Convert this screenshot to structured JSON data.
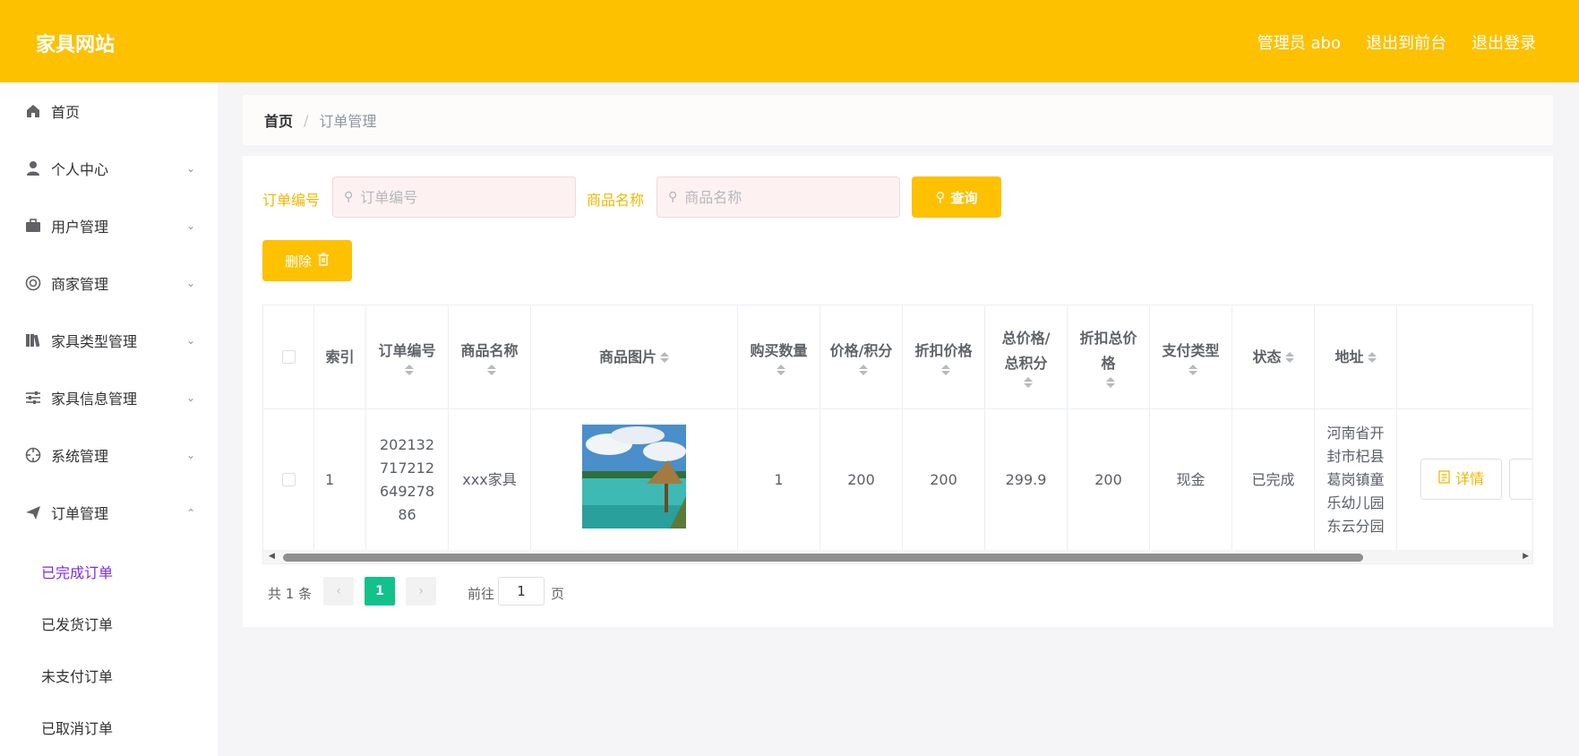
{
  "header": {
    "brand": "家具网站",
    "admin": "管理员 abo",
    "to_front": "退出到前台",
    "logout": "退出登录"
  },
  "sidebar": {
    "items": [
      {
        "label": "首页",
        "icon": "home-icon"
      },
      {
        "label": "个人中心",
        "icon": "user-icon"
      },
      {
        "label": "用户管理",
        "icon": "briefcase-icon"
      },
      {
        "label": "商家管理",
        "icon": "lifebuoy-icon"
      },
      {
        "label": "家具类型管理",
        "icon": "books-icon"
      },
      {
        "label": "家具信息管理",
        "icon": "sliders-icon"
      },
      {
        "label": "系统管理",
        "icon": "target-icon"
      },
      {
        "label": "订单管理",
        "icon": "send-icon"
      }
    ],
    "sub_items": [
      {
        "label": "已完成订单"
      },
      {
        "label": "已发货订单"
      },
      {
        "label": "未支付订单"
      },
      {
        "label": "已取消订单"
      }
    ],
    "active_color": "#7d2ae8"
  },
  "breadcrumb": {
    "home": "首页",
    "separator": "/",
    "current": "订单管理"
  },
  "search": {
    "order_no_label": "订单编号",
    "order_no_placeholder": "订单编号",
    "product_label": "商品名称",
    "product_placeholder": "商品名称",
    "query_button": "查询"
  },
  "actions": {
    "delete_button": "删除"
  },
  "table": {
    "headers": {
      "index": "索引",
      "order_no": "订单编号",
      "product_name": "商品名称",
      "product_image": "商品图片",
      "qty": "购买数量",
      "price": "价格/积分",
      "discount_price": "折扣价格",
      "total": "总价格/总积分",
      "discount_total": "折扣总价格",
      "pay_type": "支付类型",
      "status": "状态",
      "address": "地址"
    },
    "rows": [
      {
        "index": "1",
        "order_no": "20213271721264927886",
        "product_name": "xxx家具",
        "qty": "1",
        "price": "200",
        "discount_price": "200",
        "total": "299.9",
        "discount_total": "200",
        "pay_type": "现金",
        "status": "已完成",
        "address": "河南省开封市杞县葛岗镇童乐幼儿园东云分园",
        "detail_button": "详情"
      }
    ]
  },
  "pagination": {
    "total": "共 1 条",
    "current_page": "1",
    "goto_label": "前往",
    "goto_value": "1",
    "unit": "页"
  },
  "colors": {
    "brand": "#fdc100",
    "accent_text": "#f0b800",
    "pager_active": "#13c28a"
  }
}
